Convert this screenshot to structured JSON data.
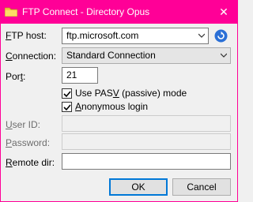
{
  "window": {
    "title": "FTP Connect - Directory Opus",
    "accent_color": "#ff0097",
    "close_glyph": "✕"
  },
  "form": {
    "ftp_host": {
      "label_prefix": "",
      "label_underlined": "F",
      "label_rest": "TP host:",
      "value": "ftp.microsoft.com"
    },
    "connection": {
      "label_prefix": "",
      "label_underlined": "C",
      "label_rest": "onnection:",
      "value": "Standard Connection"
    },
    "port": {
      "label_prefix": "Por",
      "label_underlined": "t",
      "label_rest": ":",
      "value": "21"
    },
    "pasv": {
      "label_prefix": "Use PAS",
      "label_underlined": "V",
      "label_rest": " (passive) mode",
      "checked": true
    },
    "anonymous": {
      "label_prefix": "",
      "label_underlined": "A",
      "label_rest": "nonymous login",
      "checked": true
    },
    "user_id": {
      "label_prefix": "",
      "label_underlined": "U",
      "label_rest": "ser ID:",
      "value": ""
    },
    "password": {
      "label_prefix": "",
      "label_underlined": "P",
      "label_rest": "assword:",
      "value": ""
    },
    "remote_dir": {
      "label_prefix": "",
      "label_underlined": "R",
      "label_rest": "emote dir:",
      "value": ""
    }
  },
  "buttons": {
    "ok": "OK",
    "cancel": "Cancel"
  },
  "icons": {
    "app": "folder-icon",
    "refresh": "refresh-icon",
    "dropdown": "chevron-down-icon"
  }
}
